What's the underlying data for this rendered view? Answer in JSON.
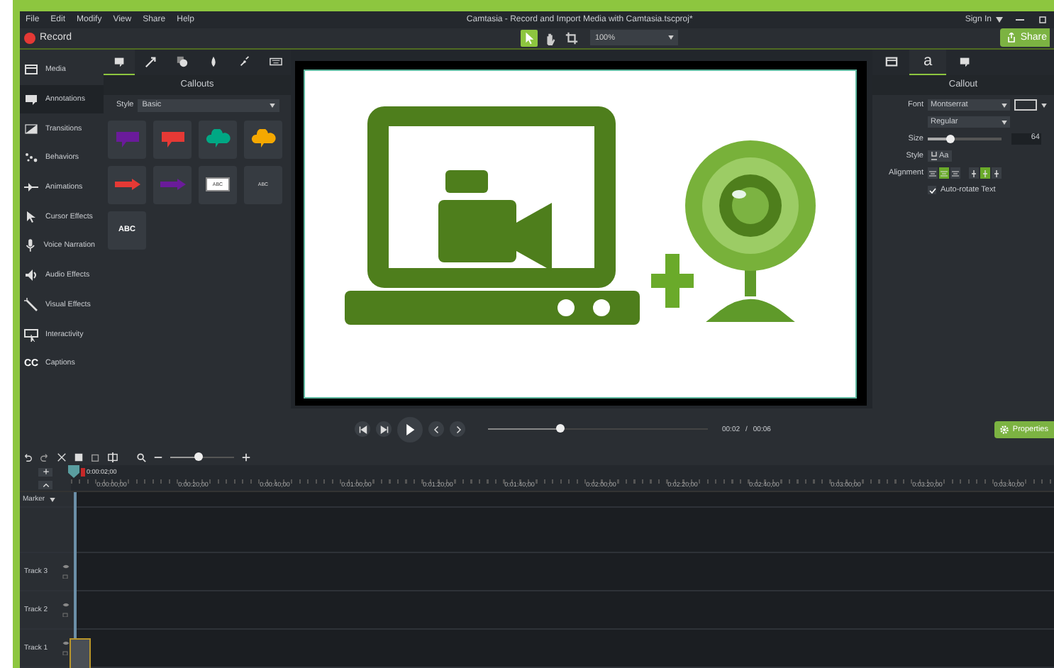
{
  "menu": [
    "File",
    "Edit",
    "Modify",
    "View",
    "Share",
    "Help"
  ],
  "window": {
    "title": "Camtasia - Record and Import Media with Camtasia.tscproj*",
    "sign_in": "Sign In"
  },
  "toolbar": {
    "record": "Record",
    "tools": [
      {
        "selected": true
      },
      {
        "selected": false
      },
      {
        "selected": false
      }
    ],
    "zoom": "100%",
    "share": "Share"
  },
  "sidebar": {
    "items": [
      {
        "label": "Media",
        "selected": false
      },
      {
        "label": "Annotations",
        "selected": true
      },
      {
        "label": "Transitions",
        "selected": false
      },
      {
        "label": "Behaviors",
        "selected": false
      },
      {
        "label": "Animations",
        "selected": false
      },
      {
        "label": "Cursor Effects",
        "selected": false
      },
      {
        "label": "Voice Narration",
        "selected": false
      },
      {
        "label": "Audio Effects",
        "selected": false
      },
      {
        "label": "Visual Effects",
        "selected": false
      },
      {
        "label": "Interactivity",
        "selected": false
      },
      {
        "label": "Captions",
        "selected": false,
        "badge": "CC"
      }
    ]
  },
  "callouts": {
    "tabs": [
      {
        "selected": true
      },
      {
        "selected": false
      },
      {
        "selected": false
      },
      {
        "selected": false
      },
      {
        "selected": false
      },
      {
        "selected": false
      }
    ],
    "title": "Callouts",
    "style_label": "Style",
    "style_value": "Basic",
    "tiles": [
      {
        "kind": "bubble",
        "color": "#6a1b9a"
      },
      {
        "kind": "bubble",
        "color": "#e53935"
      },
      {
        "kind": "cloud",
        "color": "#00a884"
      },
      {
        "kind": "cloud",
        "color": "#f5a800"
      },
      {
        "kind": "arrow",
        "color": "#e53935"
      },
      {
        "kind": "arrow",
        "color": "#6a1b9a"
      },
      {
        "kind": "box",
        "text": "ABC"
      },
      {
        "kind": "text",
        "text": "ABC"
      },
      {
        "kind": "text_large",
        "text": "ABC"
      }
    ]
  },
  "properties": {
    "tabs": [
      {
        "selected": false
      },
      {
        "label": "a",
        "selected": true
      },
      {
        "selected": false
      }
    ],
    "title": "Callout",
    "font_label": "Font",
    "font": "Montserrat",
    "weight": "Regular",
    "size": {
      "label": "Size",
      "level": 0.3,
      "value": "64"
    },
    "style": {
      "label": "Style",
      "value": "Aa"
    },
    "alignment": {
      "label": "Alignment",
      "buttons": [
        {
          "selected": false
        },
        {
          "selected": true
        },
        {
          "selected": false
        },
        {
          "selected": false
        },
        {
          "selected": true
        },
        {
          "selected": false
        }
      ]
    },
    "auto_rotate": {
      "label": "Auto-rotate Text",
      "checked": true
    }
  },
  "playback": {
    "level": 0.33,
    "time": "00:02",
    "separator": "/",
    "duration": "00:06",
    "properties": "Properties"
  },
  "timeline": {
    "zoom": {
      "level": 0.45
    },
    "playhead": "0:00:02;00",
    "ticks": [
      "0:00:00;00",
      "0:00:20;00",
      "0:00:40;00",
      "0:01:00;00",
      "0:01:20;00",
      "0:01:40;00",
      "0:02:00;00",
      "0:02:20;00",
      "0:02:40;00",
      "0:03:00;00",
      "0:03:20;00",
      "0:03:40;00"
    ],
    "marker": "Marker",
    "tracks": [
      "Track 3",
      "Track 2",
      "Track 1"
    ]
  }
}
